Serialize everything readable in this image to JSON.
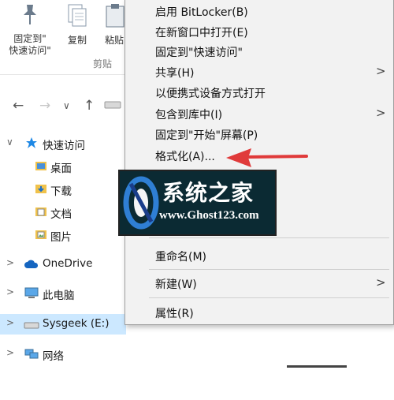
{
  "ribbon": {
    "pin_label_line1": "固定到\"",
    "pin_label_line2": "快速访问\"",
    "copy_label": "复制",
    "paste_label": "粘贴",
    "group_label": "剪贴"
  },
  "nav_tree": {
    "quick_access": "快速访问",
    "desktop": "桌面",
    "downloads": "下载",
    "documents": "文档",
    "pictures": "图片",
    "onedrive": "OneDrive",
    "this_pc": "此电脑",
    "sysgeek": "Sysgeek (E:)",
    "network": "网络"
  },
  "context_menu": {
    "items": [
      {
        "label": "启用 BitLocker(B)",
        "submenu": false
      },
      {
        "label": "在新窗口中打开(E)",
        "submenu": false
      },
      {
        "label": "固定到\"快速访问\"",
        "submenu": false
      },
      {
        "label": "共享(H)",
        "submenu": true
      },
      {
        "label": "以便携式设备方式打开",
        "submenu": false
      },
      {
        "label": "包含到库中(I)",
        "submenu": true
      },
      {
        "label": "固定到\"开始\"屏幕(P)",
        "submenu": false
      },
      {
        "label": "格式化(A)...",
        "submenu": false
      },
      {
        "label": "重命名(M)",
        "submenu": false
      },
      {
        "label": "新建(W)",
        "submenu": true
      },
      {
        "label": "属性(R)",
        "submenu": false
      }
    ]
  },
  "watermark": {
    "title": "系统之家",
    "url": "www.Ghost123.com"
  },
  "colors": {
    "menu_bg": "#f2f2f2",
    "selected_row": "#cce8ff",
    "arrow": "#e03a3a",
    "watermark_bg": "#0b2a33"
  }
}
